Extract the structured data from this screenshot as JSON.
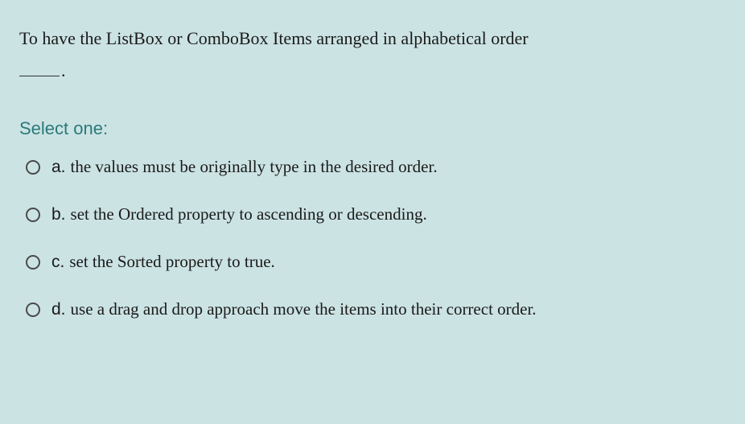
{
  "question": {
    "line1": "To have the ListBox or ComboBox Items arranged in alphabetical order",
    "blank_trailer": "."
  },
  "select_label": "Select one:",
  "options": [
    {
      "letter": "a.",
      "text": "the values must be originally type in the desired order."
    },
    {
      "letter": "b.",
      "text": "set the Ordered property to ascending or descending."
    },
    {
      "letter": "c.",
      "text": "set the Sorted property to true."
    },
    {
      "letter": "d.",
      "text": "use a drag and drop approach move the items into their correct order."
    }
  ]
}
